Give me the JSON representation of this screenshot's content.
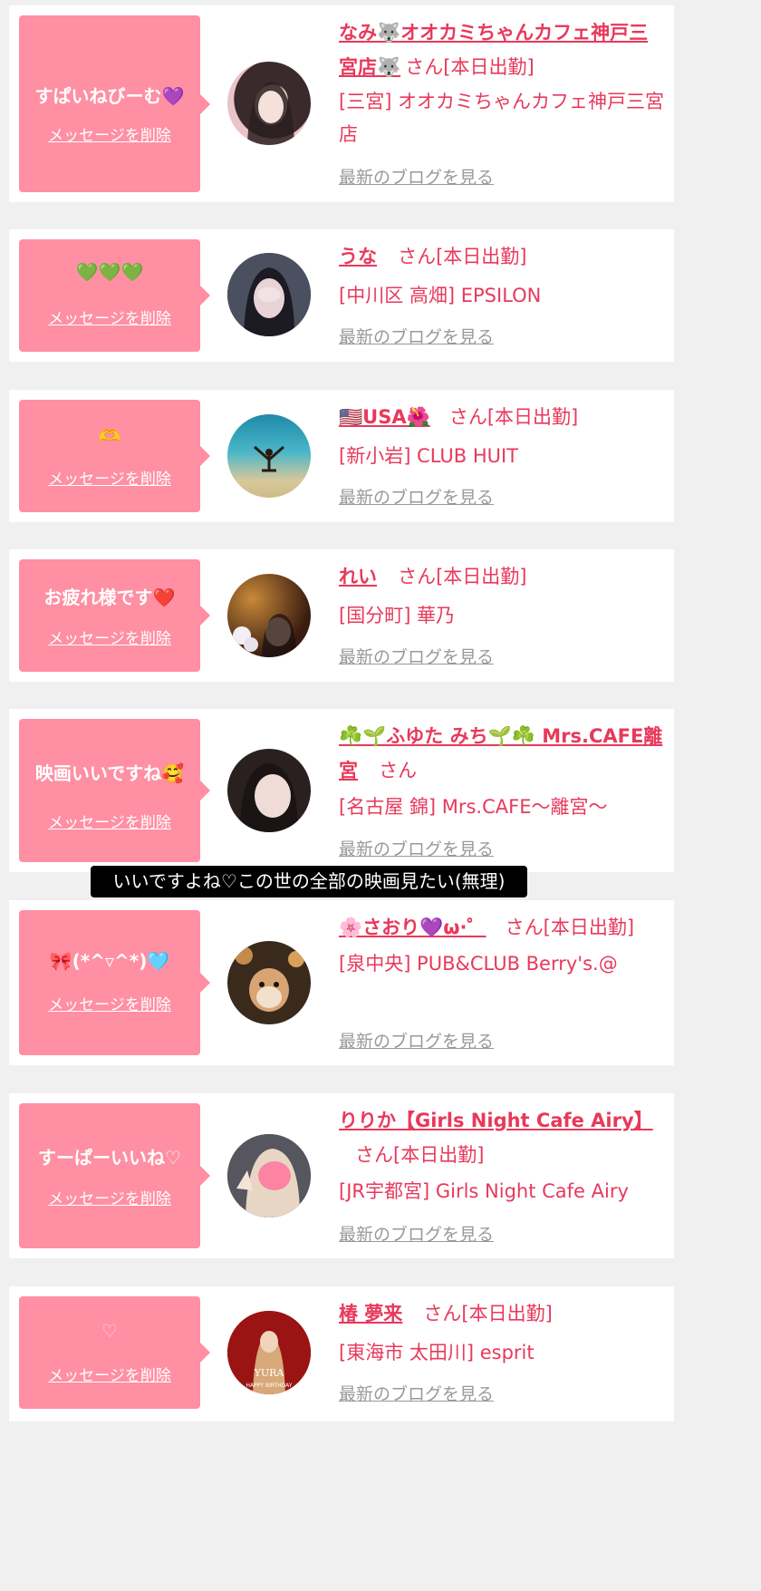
{
  "items": [
    {
      "message": "すぱいねびーむ💜",
      "delete_label": "メッセージを削除",
      "name": "なみ🐺オオカミちゃんカフェ神戸三宮店🐺",
      "status": "さん[本日出勤]",
      "shop": "[三宮] オオカミちゃんカフェ神戸三宮店",
      "blog_label": "最新のブログを見る"
    },
    {
      "message": "💚💚💚",
      "delete_label": "メッセージを削除",
      "name": "うな",
      "status": "さん[本日出勤]",
      "shop": "[中川区 高畑] EPSILON",
      "blog_label": "最新のブログを見る"
    },
    {
      "message": "🫶",
      "delete_label": "メッセージを削除",
      "name": "🇺🇸USA🌺",
      "status": "さん[本日出勤]",
      "shop": "[新小岩] CLUB HUIT",
      "blog_label": "最新のブログを見る"
    },
    {
      "message": "お疲れ様です❤️",
      "delete_label": "メッセージを削除",
      "name": "れい",
      "status": "さん[本日出勤]",
      "shop": "[国分町] 華乃",
      "blog_label": "最新のブログを見る"
    },
    {
      "message": "映画いいですね🥰",
      "delete_label": "メッセージを削除",
      "name": "☘️🌱ふゆた みち🌱☘️ Mrs.CAFE離宮",
      "status": "さん",
      "shop": "[名古屋 錦] Mrs.CAFE〜離宮〜",
      "blog_label": "最新のブログを見る"
    },
    {
      "message": "🎀(*^▿^*)🩵",
      "delete_label": "メッセージを削除",
      "name": "🌸さおり💜ω·゜",
      "status": "さん[本日出勤]",
      "shop": "[泉中央] PUB&CLUB Berry's.@",
      "blog_label": "最新のブログを見る"
    },
    {
      "message": "すーぱーいいね♡",
      "delete_label": "メッセージを削除",
      "name": "りりか【Girls Night Cafe Airy】",
      "status": "さん[本日出勤]",
      "shop": "[JR宇都宮] Girls Night Cafe Airy",
      "blog_label": "最新のブログを見る"
    },
    {
      "message": "♡",
      "delete_label": "メッセージを削除",
      "name": "椿 夢来",
      "status": "さん[本日出勤]",
      "shop": "[東海市 太田川] esprit",
      "blog_label": "最新のブログを見る"
    }
  ],
  "caption": "いいですよね♡この世の全部の映画見たい(無理)",
  "avatar_text": "YURA",
  "avatar_subtext": "HAPPY BIRTHDAY"
}
